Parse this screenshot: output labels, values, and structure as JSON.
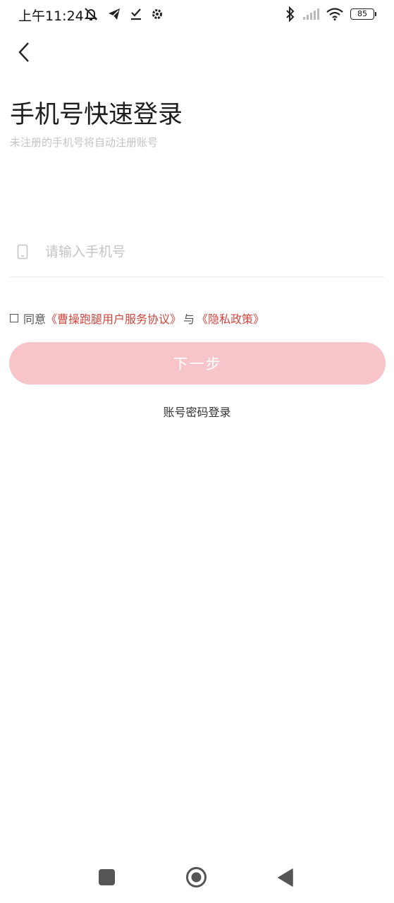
{
  "status_bar": {
    "time": "上午11:24",
    "battery": "85",
    "icons": [
      "mute-bell-icon",
      "telegram-icon",
      "download-done-icon",
      "gear-icon",
      "bluetooth-icon",
      "signal-icon",
      "wifi-icon",
      "battery-icon"
    ]
  },
  "header": {
    "back_icon": "chevron-left-icon",
    "title": "手机号快速登录",
    "subtitle": "未注册的手机号将自动注册账号"
  },
  "phone": {
    "icon": "phone-icon",
    "placeholder": "请输入手机号",
    "value": ""
  },
  "agreement": {
    "checked": false,
    "prefix": "同意",
    "service_link": "《曹操跑腿用户服务协议》",
    "conjunction": "与",
    "privacy_link": "《隐私政策》"
  },
  "next_button": {
    "label": "下一步",
    "color": "#f7c5c9"
  },
  "alt_login": {
    "label": "账号密码登录"
  },
  "colors": {
    "accent_link": "#d0463f",
    "placeholder": "#c4c4c4"
  },
  "nav_bar": {
    "icons": [
      "recents-square-icon",
      "home-circle-icon",
      "back-triangle-icon"
    ]
  }
}
